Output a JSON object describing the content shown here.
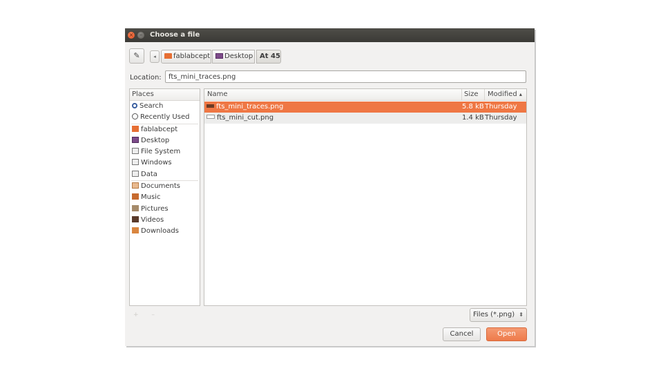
{
  "window": {
    "title": "Choose a file",
    "close_glyph": "×",
    "min_glyph": "–"
  },
  "toolbar": {
    "edit_icon": "pencil-icon",
    "back_glyph": "◂",
    "path": [
      {
        "label": "fablabcept",
        "icon": "home-folder-icon"
      },
      {
        "label": "Desktop",
        "icon": "desktop-folder-icon"
      },
      {
        "label": "At 45"
      }
    ]
  },
  "location": {
    "label": "Location:",
    "value": "fts_mini_traces.png"
  },
  "places": {
    "header": "Places",
    "items": [
      {
        "label": "Search",
        "icon": "search-icon"
      },
      {
        "label": "Recently Used",
        "icon": "clock-icon"
      },
      {
        "label": "fablabcept",
        "icon": "home-folder-icon"
      },
      {
        "label": "Desktop",
        "icon": "desktop-icon"
      },
      {
        "label": "File System",
        "icon": "drive-icon"
      },
      {
        "label": "Windows",
        "icon": "drive-icon"
      },
      {
        "label": "Data",
        "icon": "drive-icon"
      },
      {
        "label": "Documents",
        "icon": "documents-folder-icon"
      },
      {
        "label": "Music",
        "icon": "music-folder-icon"
      },
      {
        "label": "Pictures",
        "icon": "pictures-folder-icon"
      },
      {
        "label": "Videos",
        "icon": "videos-folder-icon"
      },
      {
        "label": "Downloads",
        "icon": "downloads-folder-icon"
      }
    ]
  },
  "files": {
    "columns": {
      "name": "Name",
      "size": "Size",
      "modified": "Modified",
      "sort_glyph": "▴"
    },
    "rows": [
      {
        "name": "fts_mini_traces.png",
        "size": "5.8 kB",
        "modified": "Thursday",
        "selected": true
      },
      {
        "name": "fts_mini_cut.png",
        "size": "1.4 kB",
        "modified": "Thursday",
        "selected": false
      }
    ]
  },
  "footer": {
    "add_remove": "+ –",
    "filter": "Files (*.png)",
    "filter_arrow": "⬍",
    "cancel_label": "Cancel",
    "open_label": "Open"
  },
  "colors": {
    "accent": "#ef7744",
    "titlebar": "#3d3c38",
    "selected_text": "#ffffff"
  }
}
